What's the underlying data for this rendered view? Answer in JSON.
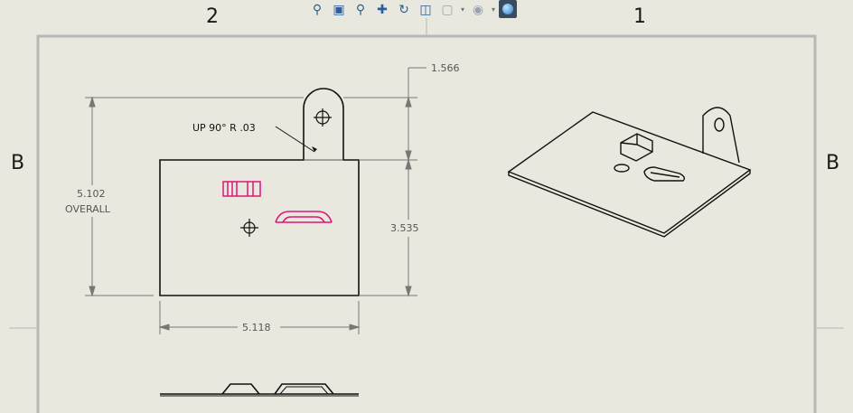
{
  "zones": {
    "top_left": "2",
    "top_right": "1",
    "left": "B",
    "right": "B"
  },
  "toolbar": {
    "icons": [
      "zoom-to-fit-icon",
      "zoom-area-icon",
      "zoom-in-out-icon",
      "pan-icon",
      "rotate-icon",
      "previous-view-icon",
      "view-orientation-icon",
      "hide-show-icon",
      "appearance-icon"
    ]
  },
  "drawing": {
    "note": "UP 90° R .03",
    "dim_height_value": "5.102",
    "dim_height_label": "OVERALL",
    "dim_tab": "1.566",
    "dim_body_height": "3.535",
    "dim_width": "5.118"
  },
  "colors": {
    "sheet": "#e9e8de",
    "border": "#b8b8b8",
    "geometry": "#111111",
    "highlight": "#e0147a",
    "dimension": "#666666"
  }
}
